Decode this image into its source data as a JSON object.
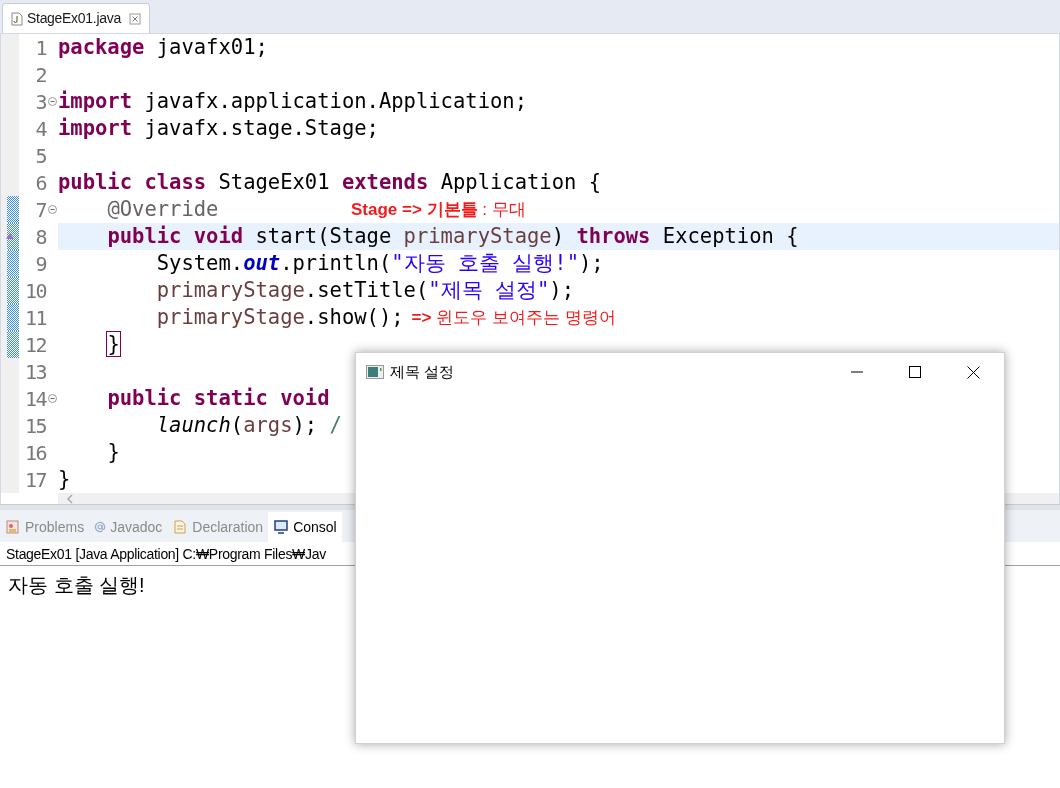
{
  "editor_tab": {
    "label": "StageEx01.java",
    "selected": true
  },
  "code_lines": [
    {
      "number": "1",
      "foldable": false,
      "changed": false,
      "current": false,
      "override": false,
      "tokens": [
        {
          "kind": "keyword",
          "text": "package"
        },
        {
          "kind": "plain",
          "text": " javafx01;"
        }
      ]
    },
    {
      "number": "2",
      "foldable": false,
      "changed": false,
      "current": false,
      "override": false
    },
    {
      "number": "3",
      "foldable": true,
      "changed": false,
      "current": false,
      "override": false,
      "tokens": [
        {
          "kind": "keyword",
          "text": "import"
        },
        {
          "kind": "plain",
          "text": " javafx.application.Application;"
        }
      ]
    },
    {
      "number": "4",
      "foldable": false,
      "changed": false,
      "current": false,
      "override": false,
      "tokens": [
        {
          "kind": "keyword",
          "text": "import"
        },
        {
          "kind": "plain",
          "text": " javafx.stage.Stage;"
        }
      ]
    },
    {
      "number": "5",
      "foldable": false,
      "changed": false,
      "current": false,
      "override": false
    },
    {
      "number": "6",
      "foldable": false,
      "changed": false,
      "current": false,
      "override": false,
      "tokens": [
        {
          "kind": "keyword",
          "text": "public class"
        },
        {
          "kind": "plain",
          "text": " StageEx01 "
        },
        {
          "kind": "keyword",
          "text": "extends"
        },
        {
          "kind": "plain",
          "text": " Application {"
        }
      ]
    },
    {
      "number": "7",
      "foldable": true,
      "changed": true,
      "current": false,
      "override": false,
      "tokens": [
        {
          "kind": "annotation",
          "text": "    @Override"
        }
      ],
      "note": "**Stage => 기본틀** : 무대"
    },
    {
      "number": "8",
      "foldable": false,
      "changed": true,
      "current": true,
      "override": true,
      "tokens": [
        {
          "kind": "keyword",
          "text": "    public void"
        },
        {
          "kind": "plain",
          "text": " start(Stage "
        },
        {
          "kind": "local",
          "text": "primaryStage"
        },
        {
          "kind": "plain",
          "text": ") "
        },
        {
          "kind": "keyword",
          "text": "throws"
        },
        {
          "kind": "plain",
          "text": " Exception {"
        }
      ]
    },
    {
      "number": "9",
      "foldable": false,
      "changed": true,
      "current": false,
      "override": false,
      "tokens": [
        {
          "kind": "plain",
          "text": "        System."
        },
        {
          "kind": "field",
          "text": "out"
        },
        {
          "kind": "plain",
          "text": ".println("
        },
        {
          "kind": "string",
          "text": "\"자동 호출 실행!\""
        },
        {
          "kind": "plain",
          "text": ");"
        }
      ]
    },
    {
      "number": "10",
      "foldable": false,
      "changed": true,
      "current": false,
      "override": false,
      "tokens": [
        {
          "kind": "local",
          "text": "        primaryStage"
        },
        {
          "kind": "plain",
          "text": ".setTitle("
        },
        {
          "kind": "string",
          "text": "\"제목 설정\""
        },
        {
          "kind": "plain",
          "text": ");"
        }
      ]
    },
    {
      "number": "11",
      "foldable": false,
      "changed": true,
      "current": false,
      "override": false,
      "tokens": [
        {
          "kind": "local",
          "text": "        primaryStage"
        },
        {
          "kind": "plain",
          "text": ".show();"
        }
      ],
      "note": "**=>** 윈도우 보여주는 명령어"
    },
    {
      "number": "12",
      "foldable": false,
      "changed": true,
      "current": false,
      "override": false,
      "tokens": [
        {
          "kind": "bracket_match",
          "text": "    }"
        }
      ]
    },
    {
      "number": "13",
      "foldable": false,
      "changed": false,
      "current": false,
      "override": false
    },
    {
      "number": "14",
      "foldable": true,
      "changed": false,
      "current": false,
      "override": false,
      "tokens": [
        {
          "kind": "keyword",
          "text": "    public static void"
        }
      ]
    },
    {
      "number": "15",
      "foldable": false,
      "changed": false,
      "current": false,
      "override": false,
      "tokens": [
        {
          "kind": "static_method",
          "text": "        launch"
        },
        {
          "kind": "plain",
          "text": "("
        },
        {
          "kind": "local",
          "text": "args"
        },
        {
          "kind": "plain",
          "text": "); "
        },
        {
          "kind": "comment",
          "text": "/"
        }
      ]
    },
    {
      "number": "16",
      "foldable": false,
      "changed": false,
      "current": false,
      "override": false,
      "tokens": [
        {
          "kind": "plain",
          "text": "    }"
        }
      ]
    },
    {
      "number": "17",
      "foldable": false,
      "changed": false,
      "current": false,
      "override": false,
      "tokens": [
        {
          "kind": "plain",
          "text": "}"
        }
      ]
    }
  ],
  "bottom_tabs": [
    {
      "label": "Problems",
      "kind": "problems",
      "selected": false
    },
    {
      "label": "Javadoc",
      "kind": "javadoc",
      "selected": false
    },
    {
      "label": "Declaration",
      "kind": "declaration",
      "selected": false
    },
    {
      "label": "Consol",
      "kind": "console",
      "selected": true
    }
  ],
  "console": {
    "header": "StageEx01 [Java Application] C:₩Program Files₩Jav",
    "output": "자동 호출 실행!"
  },
  "app_window": {
    "title": "제목 설정"
  }
}
